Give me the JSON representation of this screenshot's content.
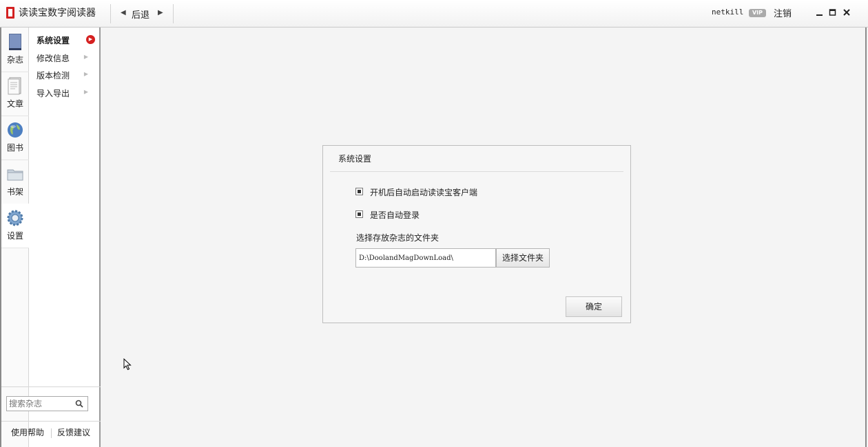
{
  "app": {
    "title": "读读宝数字阅读器",
    "back_label": "后退",
    "username": "netkill",
    "vip_badge": "VIP",
    "logout_label": "注销",
    "window_controls": [
      "minimize-icon",
      "maximize-icon",
      "close-icon"
    ]
  },
  "iconbar": {
    "items": [
      {
        "label": "杂志",
        "icon": "magazine-icon"
      },
      {
        "label": "文章",
        "icon": "article-icon"
      },
      {
        "label": "图书",
        "icon": "globe-icon"
      },
      {
        "label": "书架",
        "icon": "folder-icon"
      },
      {
        "label": "设置",
        "icon": "gear-icon",
        "active": true
      }
    ]
  },
  "submenu": {
    "items": [
      {
        "label": "系统设置",
        "active": true
      },
      {
        "label": "修改信息"
      },
      {
        "label": "版本检测"
      },
      {
        "label": "导入导出"
      }
    ]
  },
  "search": {
    "placeholder": "搜索杂志"
  },
  "footer": {
    "help": "使用帮助",
    "feedback": "反馈建议"
  },
  "dialog": {
    "title": "系统设置",
    "options": [
      {
        "label": "开机后自动启动读读宝客户端",
        "checked": true
      },
      {
        "label": "是否自动登录",
        "checked": true
      }
    ],
    "folder_label": "选择存放杂志的文件夹",
    "folder_path": "D:\\DoolandMagDownLoad\\",
    "choose_button": "选择文件夹",
    "ok_button": "确定"
  },
  "colors": {
    "accent": "#d32020",
    "panel_border": "#bdbdbd"
  }
}
